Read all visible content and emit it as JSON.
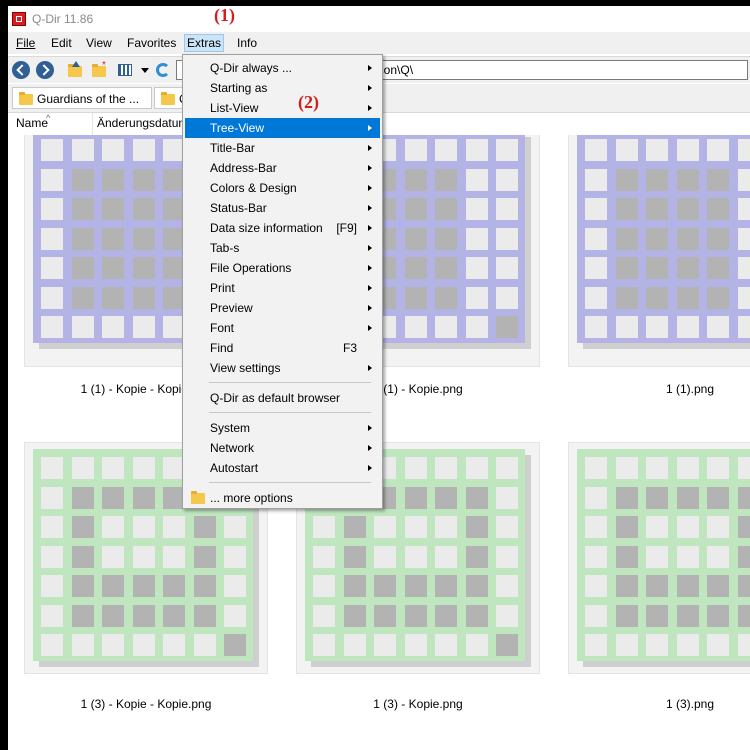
{
  "window": {
    "title": "Q-Dir 11.86"
  },
  "menubar": {
    "items": [
      "File",
      "Edit",
      "View",
      "Favorites",
      "Extras",
      "Info"
    ]
  },
  "toolbar": {
    "address": "g\\icon\\Q\\"
  },
  "tabs": [
    {
      "label": "Guardians of the ..."
    },
    {
      "label": "C"
    }
  ],
  "columns": {
    "name": "Name",
    "date": "Änderungsdatum"
  },
  "files": [
    {
      "caption": "1 (1) - Kopie - Kopie.png",
      "color": "#b3b3e6"
    },
    {
      "caption": "1 (1) - Kopie.png",
      "color": "#b3b3e6"
    },
    {
      "caption": "1 (1).png",
      "color": "#b3b3e6"
    },
    {
      "caption": "1 (3) - Kopie - Kopie.png",
      "color": "#bfe6bf"
    },
    {
      "caption": "1 (3) - Kopie.png",
      "color": "#bfe6bf"
    },
    {
      "caption": "1 (3).png",
      "color": "#bfe6bf"
    }
  ],
  "extras_menu": {
    "items": [
      {
        "label": "Q-Dir always ...",
        "arrow": true
      },
      {
        "label": "Starting as",
        "arrow": true
      },
      {
        "label": "List-View",
        "arrow": true
      },
      {
        "label": "Tree-View",
        "arrow": true,
        "highlighted": true
      },
      {
        "label": "Title-Bar",
        "arrow": true
      },
      {
        "label": "Address-Bar",
        "arrow": true
      },
      {
        "label": "Colors & Design",
        "arrow": true
      },
      {
        "label": "Status-Bar",
        "arrow": true
      },
      {
        "label": "Data size information",
        "shortcut": "[F9]",
        "arrow": true
      },
      {
        "label": "Tab-s",
        "arrow": true
      },
      {
        "label": "File Operations",
        "arrow": true
      },
      {
        "label": "Print",
        "arrow": true
      },
      {
        "label": "Preview",
        "arrow": true
      },
      {
        "label": "Font",
        "arrow": true
      },
      {
        "label": "Find",
        "shortcut": "F3",
        "arrow": false
      },
      {
        "label": "View settings",
        "arrow": true
      },
      {
        "separator": true
      },
      {
        "label": "Q-Dir as default browser",
        "arrow": false
      },
      {
        "separator": true
      },
      {
        "label": "System",
        "arrow": true
      },
      {
        "label": "Network",
        "arrow": true
      },
      {
        "label": "Autostart",
        "arrow": true
      },
      {
        "separator": true
      },
      {
        "label": "... more options",
        "arrow": false,
        "icon": "folder-icon"
      }
    ]
  },
  "annotations": [
    "(1)",
    "(2)"
  ],
  "colors": {
    "menu_highlight": "#0078d7",
    "annotation": "#d11f1f",
    "thumb_gray": "#b3b3b3",
    "thumb_light": "#ebebeb"
  }
}
